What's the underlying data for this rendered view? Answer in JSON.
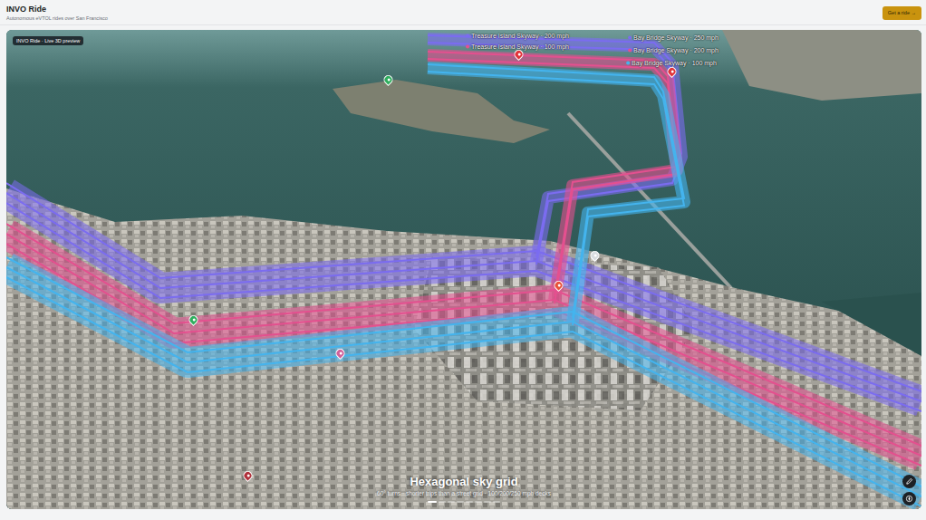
{
  "header": {
    "title": "INVO Ride",
    "subtitle": "Autonomous eVTOL rides over San Francisco",
    "button": "Get a ride →"
  },
  "map": {
    "badge": "INVO Ride · Live 3D preview",
    "lanes": [
      {
        "color": "#7b6cf0"
      },
      {
        "color": "#e4508f"
      },
      {
        "color": "#44b4ee"
      }
    ],
    "skyways": [
      {
        "label": "Treasure Island Skyway · 200 mph",
        "color": "#7b6cf0"
      },
      {
        "label": "Treasure Island Skyway · 100 mph",
        "color": "#e4508f"
      },
      {
        "label": "Bay Bridge Skyway · 250 mph",
        "color": "#7b6cf0"
      },
      {
        "label": "Bay Bridge Skyway · 200 mph",
        "color": "#e4508f"
      },
      {
        "label": "Bay Bridge Skyway · 100 mph",
        "color": "#44b4ee"
      }
    ],
    "pins": [
      {
        "color": "#2fae5e"
      },
      {
        "color": "#2fae5e"
      },
      {
        "color": "#e0343a"
      },
      {
        "color": "#e0343a"
      },
      {
        "color": "#e8533a"
      },
      {
        "color": "#d9dde0"
      },
      {
        "color": "#b0303a"
      },
      {
        "color": "#d0609a"
      }
    ],
    "caption": {
      "title": "Hexagonal sky grid",
      "subtitle": "60° turns · shorter trips than a street grid · 100/200/250 mph decks"
    },
    "slides": [
      {
        "selected": true
      },
      {
        "selected": false
      },
      {
        "selected": false
      },
      {
        "selected": false
      },
      {
        "selected": false
      },
      {
        "selected": false
      },
      {
        "selected": false
      },
      {
        "selected": false
      }
    ]
  }
}
